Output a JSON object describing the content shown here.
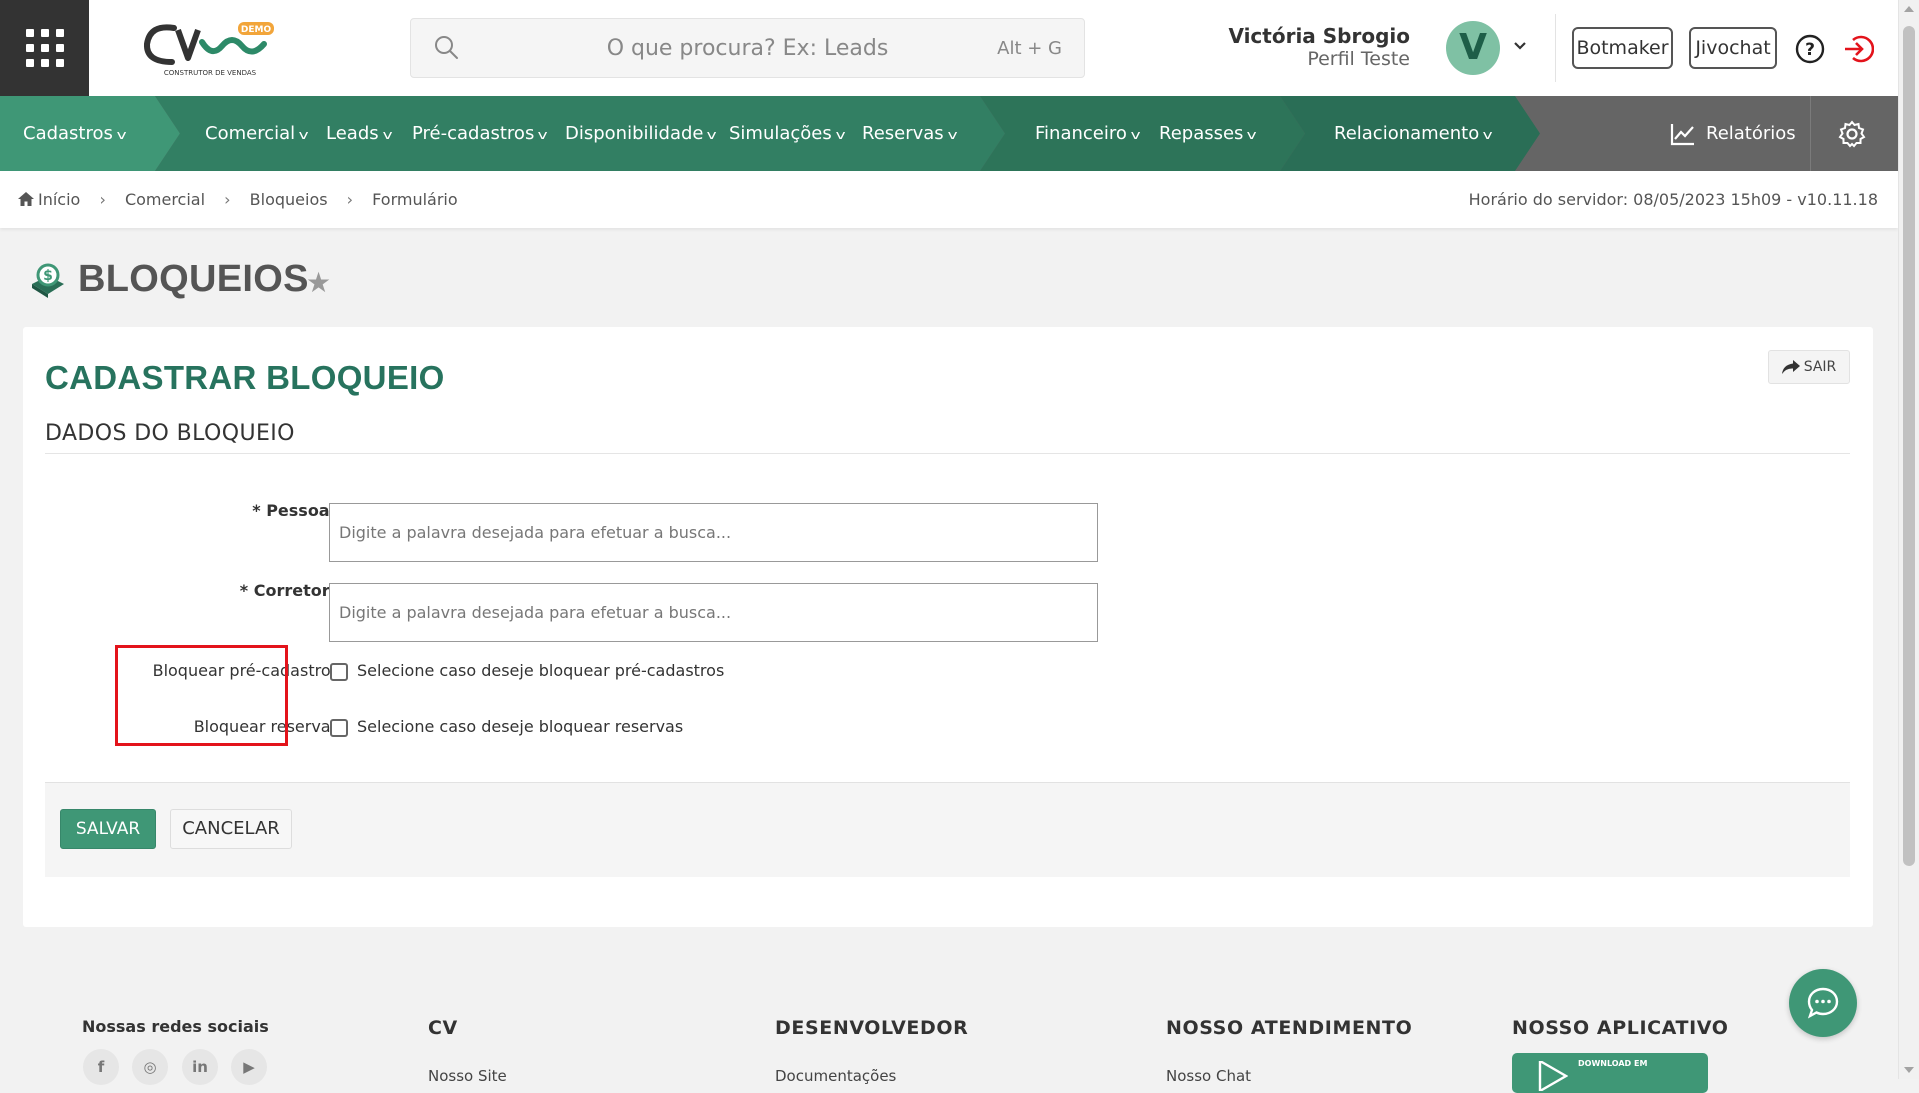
{
  "header": {
    "search_placeholder": "O que procura? Ex: Leads",
    "search_shortcut": "Alt + G",
    "user_name": "Victória Sbrogio",
    "user_role": "Perfil Teste",
    "avatar_initial": "V",
    "botmaker_label": "Botmaker",
    "jivochat_label": "Jivochat",
    "logo_badge": "DEMO",
    "logo_tagline": "CONSTRUTOR DE VENDAS"
  },
  "nav": {
    "items": [
      {
        "label": "Cadastros"
      },
      {
        "label": "Comercial"
      },
      {
        "label": "Leads"
      },
      {
        "label": "Pré-cadastros"
      },
      {
        "label": "Disponibilidade"
      },
      {
        "label": "Simulações"
      },
      {
        "label": "Reservas"
      },
      {
        "label": "Financeiro"
      },
      {
        "label": "Repasses"
      },
      {
        "label": "Relacionamento"
      }
    ],
    "reports_label": "Relatórios",
    "colors": {
      "green_1": "#3f9776",
      "green_2": "#327f63",
      "green_3": "#2a6e56",
      "gray": "#656565"
    }
  },
  "breadcrumb": {
    "items": [
      "Início",
      "Comercial",
      "Bloqueios",
      "Formulário"
    ],
    "server_time": "Horário do servidor: 08/05/2023 15h09 - v10.11.18"
  },
  "page": {
    "title": "BLOQUEIOS",
    "form_title": "CADASTRAR BLOQUEIO",
    "exit_label": "SAIR",
    "section_title": "DADOS DO BLOQUEIO",
    "fields": {
      "pessoa_label": "* Pessoa:",
      "pessoa_placeholder": "Digite a palavra desejada para efetuar a busca...",
      "corretor_label": "* Corretor:",
      "corretor_placeholder": "Digite a palavra desejada para efetuar a busca...",
      "bloquear_pre_label": "Bloquear pré-cadastro:",
      "bloquear_pre_text": "Selecione caso deseje bloquear pré-cadastros",
      "bloquear_pre_checked": false,
      "bloquear_reserva_label": "Bloquear reserva:",
      "bloquear_reserva_text": "Selecione caso deseje bloquear reservas",
      "bloquear_reserva_checked": false
    },
    "save_label": "SALVAR",
    "cancel_label": "CANCELAR",
    "highlight_color": "#e3131b"
  },
  "footer": {
    "social_title": "Nossas redes sociais",
    "social_icons": [
      "facebook-icon",
      "instagram-icon",
      "linkedin-icon",
      "youtube-icon"
    ],
    "cols": [
      {
        "title": "CV",
        "link": "Nosso Site"
      },
      {
        "title": "DESENVOLVEDOR",
        "link": "Documentações"
      },
      {
        "title": "NOSSO ATENDIMENTO",
        "link": "Nosso Chat"
      },
      {
        "title": "NOSSO APLICATIVO"
      }
    ],
    "app_badge_text": "DOWNLOAD EM"
  }
}
